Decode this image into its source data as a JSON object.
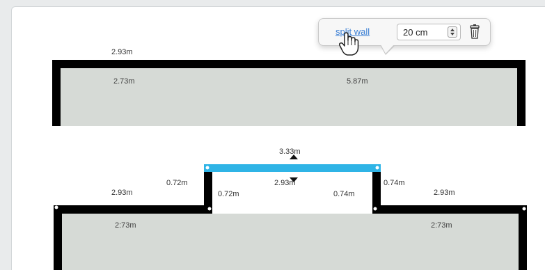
{
  "popover": {
    "split_wall_label": "split wall",
    "thickness_value": "20 cm",
    "stepper_up_icon": "chevron-up-icon",
    "stepper_down_icon": "chevron-down-icon",
    "delete_icon": "trash-icon"
  },
  "cursor": {
    "icon": "hand-pointer-icon"
  },
  "colors": {
    "wall": "#000000",
    "room_fill": "#d6dad6",
    "selected_wall": "#2fb4e6",
    "canvas": "#ffffff",
    "link": "#3b7fd4"
  },
  "top_plan": {
    "outer_width": "2.93m",
    "inner_left": "2.73m",
    "inner_right": "5.87m"
  },
  "bottom_plan": {
    "selected_wall_length": "3.33m",
    "selected_wall_inner": "2.93m",
    "left_step_outer": "0.72m",
    "left_step_inner": "0.72m",
    "right_step_inner": "0.74m",
    "right_step_outer": "0.74m",
    "left_outer_width": "2.93m",
    "right_outer_width": "2.93m",
    "left_inner_width": "2:73m",
    "right_inner_width": "2:73m"
  }
}
